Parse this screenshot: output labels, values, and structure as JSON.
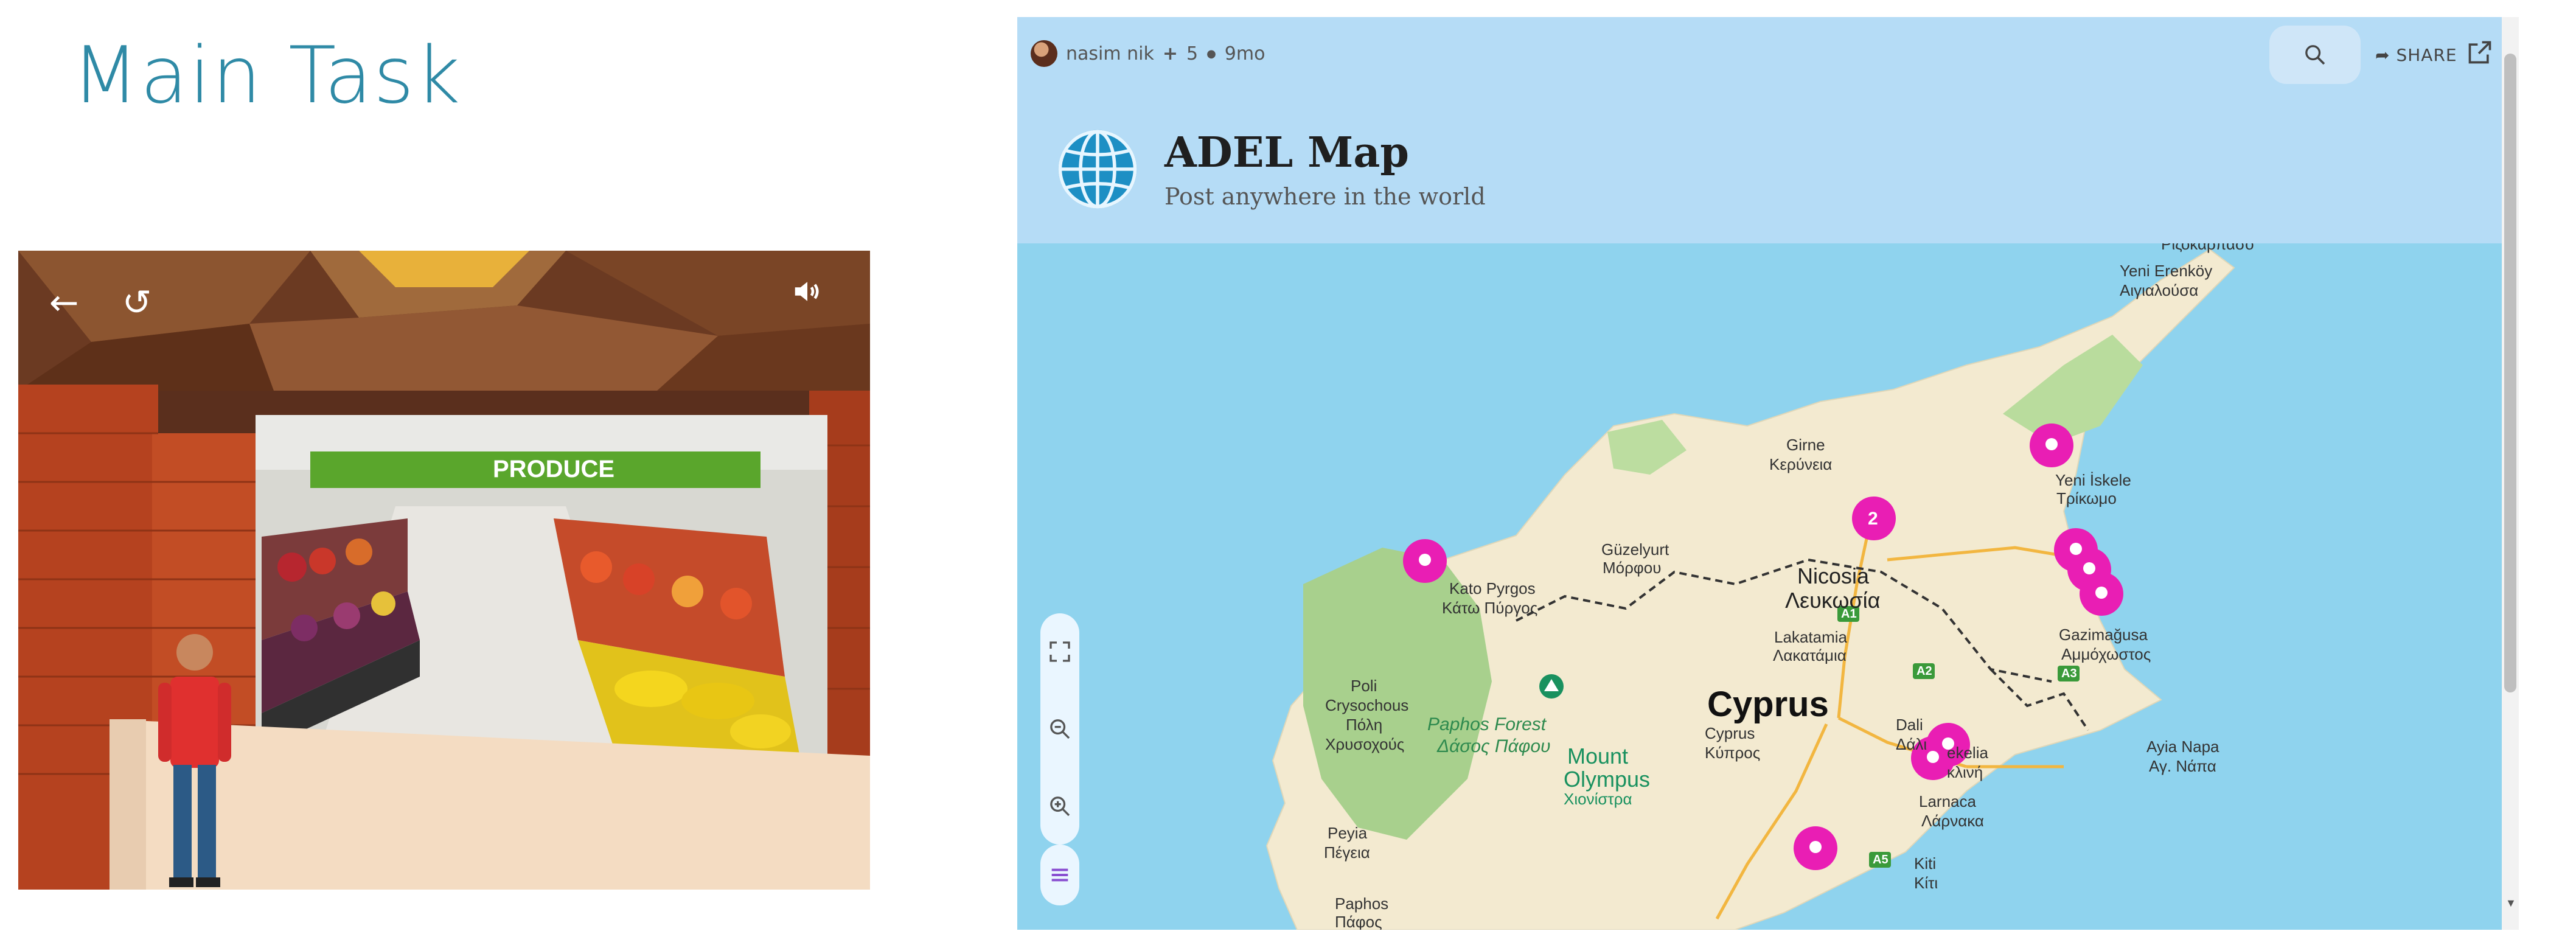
{
  "slide": {
    "title": "Main Task"
  },
  "game": {
    "back_icon": "arrow-left-icon",
    "reload_icon": "reload-icon",
    "sound_icon": "speaker-icon",
    "store_sign": "PRODUCE"
  },
  "map_app": {
    "user": "nasim nik",
    "plus_count": "5",
    "age": "9mo",
    "share_label": "SHARE",
    "title": "ADEL Map",
    "subtitle": "Post anywhere in the world",
    "scroll_arrow": "▼",
    "places": {
      "top_label": "Ριζοκάρπασο",
      "yeni_erenkoy": "Yeni Erenköy",
      "aigialousa": "Αιγιαλούσα",
      "girne": "Girne",
      "keryneia": "Κερύνεια",
      "yeni_iskele": "Yeni İskele",
      "trikomo": "Τρίκωμο",
      "guzelyurt": "Güzelyurt",
      "morfou": "Μόρφου",
      "nicosia": "Nicosia",
      "lefkosia": "Λευκωσία",
      "kato_pyrgos": "Kato Pyrgos",
      "kato_pyrgos_gr": "Κάτω Πύργος",
      "lakatamia": "Lakatamia",
      "lakatamia_gr": "Λακατάμια",
      "gazimagusa": "Gazimağusa",
      "ammochostos": "Αμμόχωστος",
      "poli": "Poli",
      "crysochous": "Crysochous",
      "poli_gr": "Πόλη",
      "chrysochous_gr": "Χρυσοχούς",
      "cyprus": "Cyprus",
      "dali": "Dali",
      "dali_gr": "Δάλι",
      "cyprus_small": "Cyprus",
      "kypros": "Κύπρος",
      "paphos_forest": "Paphos Forest",
      "paphos_forest_gr": "Δάσος Πάφου",
      "mount": "Mount",
      "olympus": "Olympus",
      "chionistra": "Χιονίστρα",
      "dekelia": "ekelia",
      "dekelia_gr": "κλινή",
      "ayia_napa": "Ayia Napa",
      "ayia_napa_gr": "Αγ. Νάπα",
      "larnaca": "Larnaca",
      "larnaka_gr": "Λάρνακα",
      "peyia": "Peyia",
      "peyia_gr": "Πέγεια",
      "kiti": "Kiti",
      "kiti_gr": "Κίτι",
      "paphos": "Paphos",
      "paphos_gr": "Πάφος"
    },
    "road_labels": [
      "A1",
      "A2",
      "A3",
      "A5"
    ],
    "cluster_count": "2",
    "pin_color": "#e91eb4"
  }
}
